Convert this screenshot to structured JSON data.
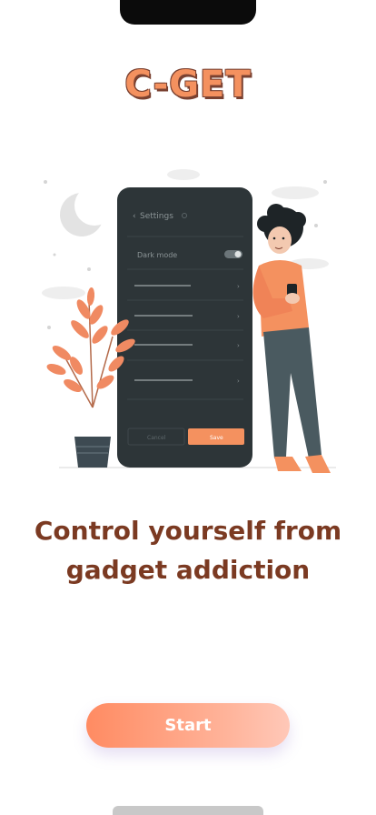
{
  "app": {
    "logo_text": "C-GET"
  },
  "illustration": {
    "settings_title": "Settings",
    "dark_mode_label": "Dark mode",
    "cancel_label": "Cancel",
    "save_label": "Save",
    "accent_color": "#f4915f",
    "phone_color": "#2d3538"
  },
  "headline": {
    "line1": "Control yourself from",
    "line2": "gadget addiction"
  },
  "start_button": {
    "label": "Start"
  }
}
